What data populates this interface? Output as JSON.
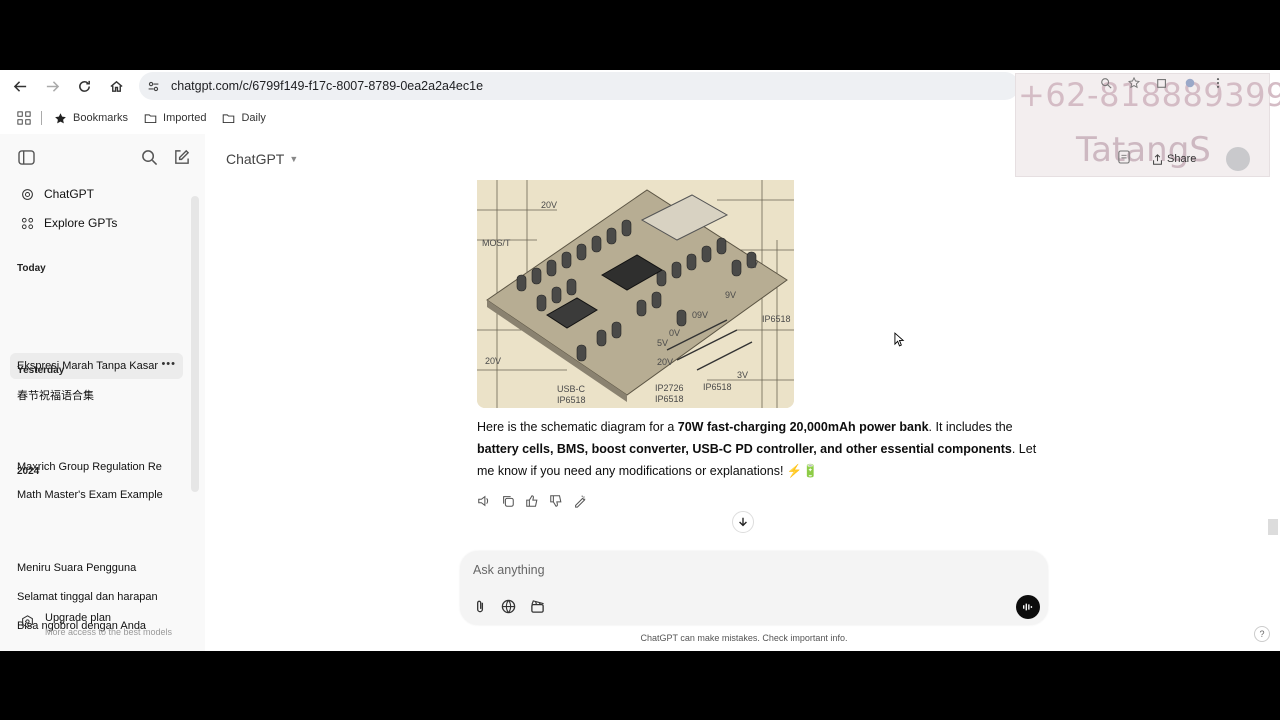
{
  "browser": {
    "url": "chatgpt.com/c/6799f149-f17c-8007-8789-0ea2a2a4ec1e",
    "bookmarks": [
      {
        "label": "Bookmarks",
        "icon": "star-icon"
      },
      {
        "label": "Imported",
        "icon": "folder-icon"
      },
      {
        "label": "Daily",
        "icon": "folder-icon"
      }
    ]
  },
  "sidebar": {
    "nav": [
      {
        "label": "ChatGPT",
        "icon": "openai-logo-icon"
      },
      {
        "label": "Explore GPTs",
        "icon": "grid-icon"
      }
    ],
    "sections": [
      {
        "title": "Today",
        "items": [
          "Ekspresi Marah Tanpa Kasar",
          "春节祝福语合集"
        ]
      },
      {
        "title": "Yesterday",
        "items": [
          "Maxrich Group Regulation Re",
          "Math Master's Exam Example"
        ]
      },
      {
        "title": "2024",
        "items": [
          "Meniru Suara Pengguna",
          "Selamat tinggal dan harapan",
          "Bisa ngobrol dengan Anda"
        ]
      }
    ],
    "upgrade": {
      "title": "Upgrade plan",
      "subtitle": "More access to the best models"
    }
  },
  "header": {
    "model": "ChatGPT",
    "share_label": "Share"
  },
  "watermark": {
    "phone": "+62-818889399",
    "name": "TatangS"
  },
  "image_labels": {
    "l1": "20V",
    "l2": "MOS/T",
    "l3": "5V",
    "l4": "9V",
    "l5": "IP6518",
    "l6": "09V",
    "l7": "0V",
    "l8": "5V",
    "l9": "20V",
    "l10": "USB-C",
    "l11": "IP6518",
    "l12": "IP2726",
    "l13": "IP6518",
    "l14": "IP6518",
    "l15": "3V",
    "l16": "20V"
  },
  "message": {
    "intro": "Here is the schematic diagram for a ",
    "bold1": "70W fast-charging 20,000mAh power bank",
    "mid": ". It includes the ",
    "bold2": "battery cells, BMS, boost converter, USB-C PD controller, and other essential components",
    "outro": ". Let me know if you need any modifications or explanations! ⚡🔋"
  },
  "composer": {
    "placeholder": "Ask anything"
  },
  "disclaimer": "ChatGPT can make mistakes. Check important info.",
  "help_label": "?"
}
